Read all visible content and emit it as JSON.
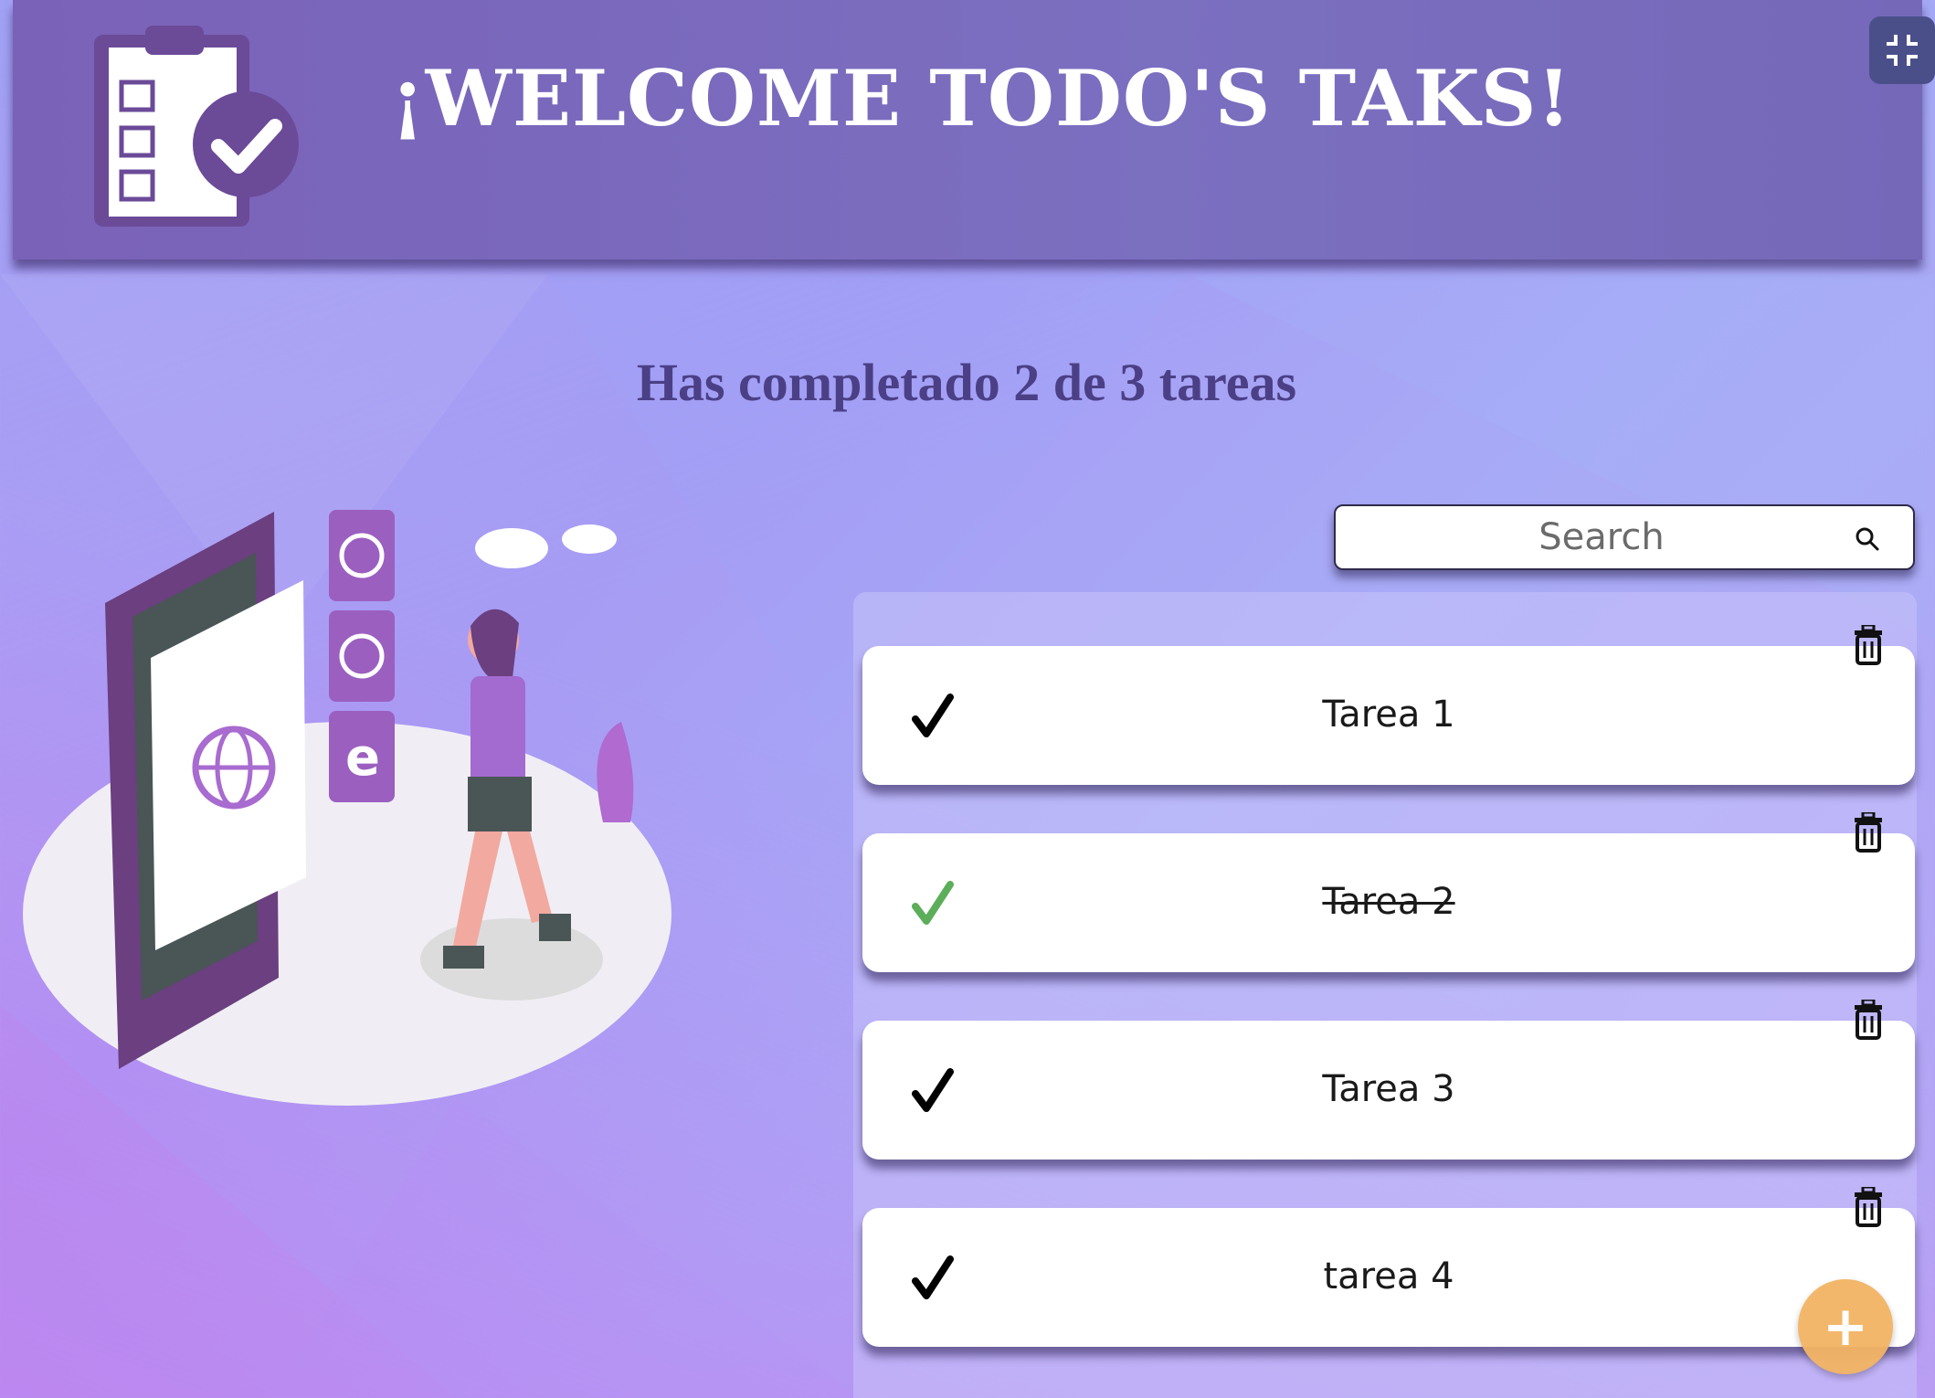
{
  "header": {
    "title": "¡WELCOME TODO'S TAKS!",
    "logo_icon": "clipboard-check-icon",
    "fullscreen_icon": "exit-fullscreen-icon"
  },
  "counter": {
    "text": "Has completado 2 de 3 tareas"
  },
  "search": {
    "placeholder": "Search",
    "value": "",
    "icon": "search-icon"
  },
  "todos": [
    {
      "text": "Tarea 1",
      "completed": false,
      "check_color": "#000000"
    },
    {
      "text": "Tarea 2",
      "completed": true,
      "check_color": "#5cae5a"
    },
    {
      "text": "Tarea 3",
      "completed": false,
      "check_color": "#000000"
    },
    {
      "text": "tarea 4",
      "completed": false,
      "check_color": "#000000"
    }
  ],
  "fab": {
    "label": "+"
  },
  "colors": {
    "header": "#7a62b8",
    "counter_text": "#4b3f86",
    "fab": "#f2b463",
    "accent_purple": "#8a5cc0"
  }
}
